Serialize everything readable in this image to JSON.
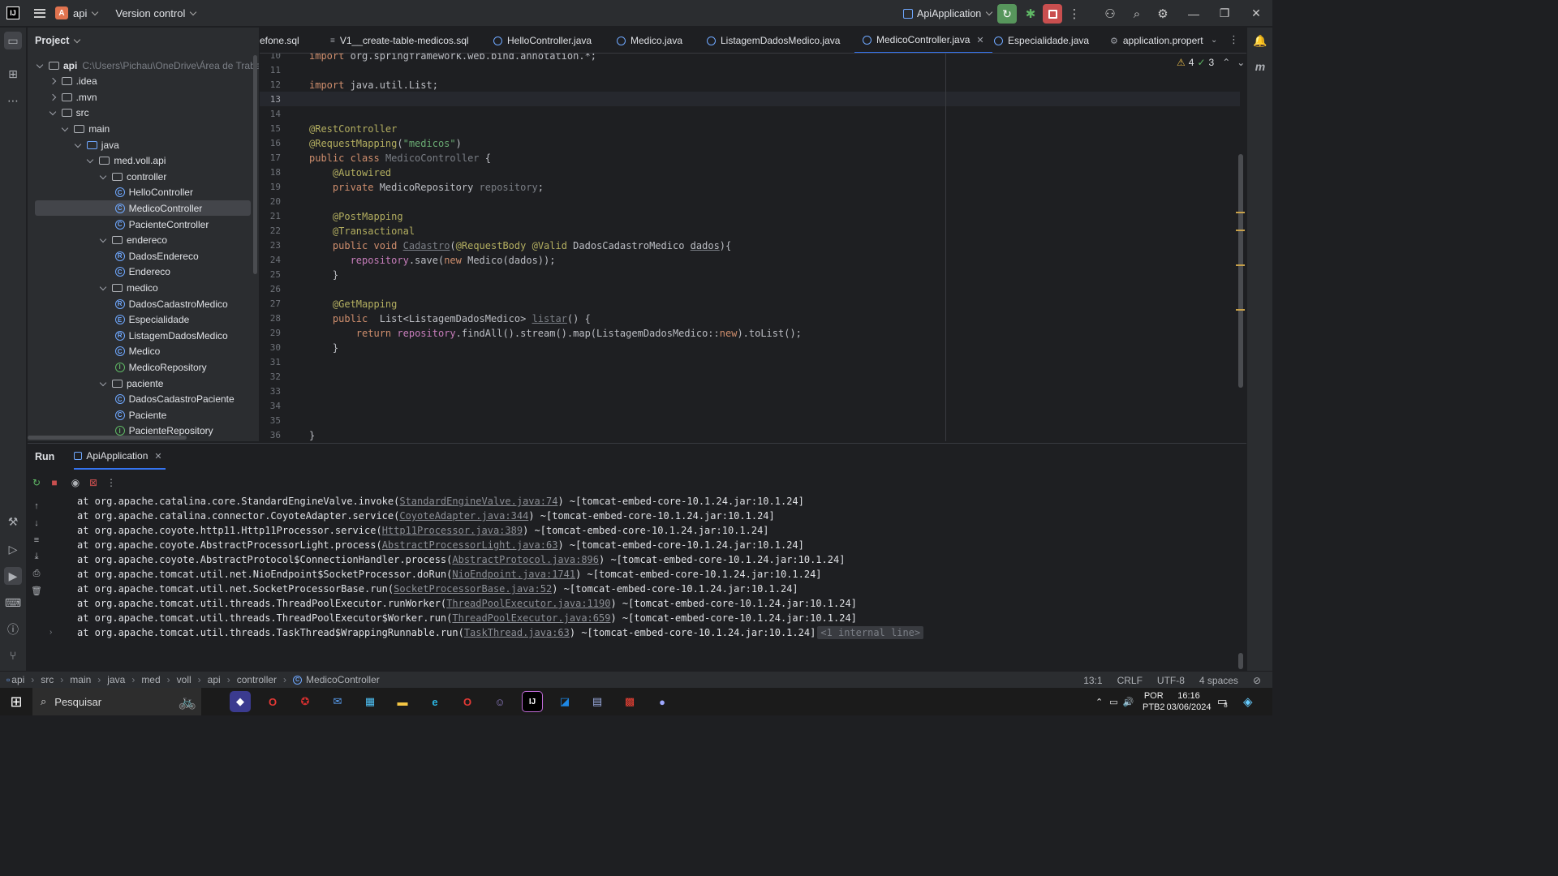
{
  "titlebar": {
    "project_badge": "A",
    "project_name": "api",
    "vcs_label": "Version control",
    "run_config": "ApiApplication",
    "colors": {
      "rerun": "#57965c",
      "stop": "#c94f4f",
      "badge": "#e0734f"
    }
  },
  "project_panel": {
    "title": "Project",
    "tree": [
      {
        "label": "api",
        "hint": "C:\\Users\\Pichau\\OneDrive\\Área de Trabalho",
        "type": "module",
        "arrow": "down",
        "indent": 0
      },
      {
        "label": ".idea",
        "type": "folder",
        "arrow": "right",
        "indent": 1
      },
      {
        "label": ".mvn",
        "type": "folder",
        "arrow": "right",
        "indent": 1
      },
      {
        "label": "src",
        "type": "folder",
        "arrow": "down",
        "indent": 1
      },
      {
        "label": "main",
        "type": "folder",
        "arrow": "down",
        "indent": 2
      },
      {
        "label": "java",
        "type": "folder-blue",
        "arrow": "down",
        "indent": 3
      },
      {
        "label": "med.voll.api",
        "type": "package",
        "arrow": "down",
        "indent": 4
      },
      {
        "label": "controller",
        "type": "package",
        "arrow": "down",
        "indent": 5
      },
      {
        "label": "HelloController",
        "type": "class",
        "indent": 6
      },
      {
        "label": "MedicoController",
        "type": "class",
        "indent": 6,
        "selected": true
      },
      {
        "label": "PacienteController",
        "type": "class",
        "indent": 6
      },
      {
        "label": "endereco",
        "type": "package",
        "arrow": "down",
        "indent": 5
      },
      {
        "label": "DadosEndereco",
        "type": "record",
        "indent": 6
      },
      {
        "label": "Endereco",
        "type": "class",
        "indent": 6
      },
      {
        "label": "medico",
        "type": "package",
        "arrow": "down",
        "indent": 5
      },
      {
        "label": "DadosCadastroMedico",
        "type": "record",
        "indent": 6
      },
      {
        "label": "Especialidade",
        "type": "enum",
        "indent": 6
      },
      {
        "label": "ListagemDadosMedico",
        "type": "record",
        "indent": 6
      },
      {
        "label": "Medico",
        "type": "class",
        "indent": 6
      },
      {
        "label": "MedicoRepository",
        "type": "interface",
        "indent": 6
      },
      {
        "label": "paciente",
        "type": "package",
        "arrow": "down",
        "indent": 5
      },
      {
        "label": "DadosCadastroPaciente",
        "type": "class",
        "indent": 6
      },
      {
        "label": "Paciente",
        "type": "class",
        "indent": 6
      },
      {
        "label": "PacienteRepository",
        "type": "interface",
        "indent": 6
      }
    ]
  },
  "editor_tabs": [
    {
      "label": "efone.sql",
      "icon": "sql"
    },
    {
      "label": "V1__create-table-medicos.sql",
      "icon": "sql"
    },
    {
      "label": "HelloController.java",
      "icon": "class"
    },
    {
      "label": "Medico.java",
      "icon": "class"
    },
    {
      "label": "ListagemDadosMedico.java",
      "icon": "record"
    },
    {
      "label": "MedicoController.java",
      "icon": "class",
      "active": true
    },
    {
      "label": "Especialidade.java",
      "icon": "enum"
    },
    {
      "label": "application.propert",
      "icon": "gear"
    }
  ],
  "inspections": {
    "warnings": "4",
    "checks": "3"
  },
  "code_lines": [
    {
      "n": "10",
      "html": "<span class=\"kw\">import</span> org.springframework.web.bind.annotation.*;"
    },
    {
      "n": "11",
      "html": ""
    },
    {
      "n": "12",
      "html": "<span class=\"kw\">import</span> java.util.List;"
    },
    {
      "n": "13",
      "html": ""
    },
    {
      "n": "14",
      "html": ""
    },
    {
      "n": "15",
      "html": "<span class=\"ann\">@RestController</span>"
    },
    {
      "n": "16",
      "html": "<span class=\"ann\">@RequestMapping</span>(<span class=\"str\">\"medicos\"</span>)"
    },
    {
      "n": "17",
      "html": "<span class=\"kw\">public class</span> <span class=\"dim\">MedicoController</span> {"
    },
    {
      "n": "18",
      "html": "    <span class=\"ann\">@Autowired</span>"
    },
    {
      "n": "19",
      "html": "    <span class=\"kw\">private</span> MedicoRepository <span class=\"dim\">repository</span>;"
    },
    {
      "n": "20",
      "html": ""
    },
    {
      "n": "21",
      "html": "    <span class=\"ann\">@PostMapping</span>"
    },
    {
      "n": "22",
      "html": "    <span class=\"ann\">@Transactional</span>"
    },
    {
      "n": "23",
      "html": "    <span class=\"kw\">public void</span> <span class=\"dim under\">Cadastro</span>(<span class=\"ann\">@RequestBody</span> <span class=\"ann\">@Valid</span> DadosCadastroMedico <span class=\"under\">dados</span>){"
    },
    {
      "n": "24",
      "html": "       <span class=\"fld\">repository</span>.save(<span class=\"kw\">new</span> Medico(dados));"
    },
    {
      "n": "25",
      "html": "    }"
    },
    {
      "n": "26",
      "html": ""
    },
    {
      "n": "27",
      "html": "    <span class=\"ann\">@GetMapping</span>"
    },
    {
      "n": "28",
      "html": "    <span class=\"kw\">public</span>  List&lt;ListagemDadosMedico&gt; <span class=\"dim under\">listar</span>() {"
    },
    {
      "n": "29",
      "html": "        <span class=\"kw\">return</span> <span class=\"fld\">repository</span>.findAll().stream().map(ListagemDadosMedico::<span class=\"kw\">new</span>).toList();"
    },
    {
      "n": "30",
      "html": "    }"
    },
    {
      "n": "31",
      "html": ""
    },
    {
      "n": "32",
      "html": ""
    },
    {
      "n": "33",
      "html": ""
    },
    {
      "n": "34",
      "html": ""
    },
    {
      "n": "35",
      "html": ""
    },
    {
      "n": "36",
      "html": "}"
    }
  ],
  "run_panel": {
    "label": "Run",
    "tab": "ApiApplication",
    "log": [
      {
        "pre": "at org.apache.catalina.core.StandardEngineValve.invoke(",
        "link": "StandardEngineValve.java:74",
        "post": ") ~[tomcat-embed-core-10.1.24.jar:10.1.24]"
      },
      {
        "pre": "at org.apache.catalina.connector.CoyoteAdapter.service(",
        "link": "CoyoteAdapter.java:344",
        "post": ") ~[tomcat-embed-core-10.1.24.jar:10.1.24]"
      },
      {
        "pre": "at org.apache.coyote.http11.Http11Processor.service(",
        "link": "Http11Processor.java:389",
        "post": ") ~[tomcat-embed-core-10.1.24.jar:10.1.24]"
      },
      {
        "pre": "at org.apache.coyote.AbstractProcessorLight.process(",
        "link": "AbstractProcessorLight.java:63",
        "post": ") ~[tomcat-embed-core-10.1.24.jar:10.1.24]"
      },
      {
        "pre": "at org.apache.coyote.AbstractProtocol$ConnectionHandler.process(",
        "link": "AbstractProtocol.java:896",
        "post": ") ~[tomcat-embed-core-10.1.24.jar:10.1.24]"
      },
      {
        "pre": "at org.apache.tomcat.util.net.NioEndpoint$SocketProcessor.doRun(",
        "link": "NioEndpoint.java:1741",
        "post": ") ~[tomcat-embed-core-10.1.24.jar:10.1.24]"
      },
      {
        "pre": "at org.apache.tomcat.util.net.SocketProcessorBase.run(",
        "link": "SocketProcessorBase.java:52",
        "post": ") ~[tomcat-embed-core-10.1.24.jar:10.1.24]"
      },
      {
        "pre": "at org.apache.tomcat.util.threads.ThreadPoolExecutor.runWorker(",
        "link": "ThreadPoolExecutor.java:1190",
        "post": ") ~[tomcat-embed-core-10.1.24.jar:10.1.24]"
      },
      {
        "pre": "at org.apache.tomcat.util.threads.ThreadPoolExecutor$Worker.run(",
        "link": "ThreadPoolExecutor.java:659",
        "post": ") ~[tomcat-embed-core-10.1.24.jar:10.1.24]"
      },
      {
        "pre": "at org.apache.tomcat.util.threads.TaskThread$WrappingRunnable.run(",
        "link": "TaskThread.java:63",
        "post": ") ~[tomcat-embed-core-10.1.24.jar:10.1.24]",
        "internal": "<1 internal line>"
      }
    ]
  },
  "statusbar": {
    "breadcrumb": [
      "api",
      "src",
      "main",
      "java",
      "med",
      "voll",
      "api",
      "controller",
      "MedicoController"
    ],
    "position": "13:1",
    "line_sep": "CRLF",
    "encoding": "UTF-8",
    "indent": "4 spaces"
  },
  "taskbar": {
    "search_placeholder": "Pesquisar",
    "lang1": "POR",
    "lang2": "PTB2",
    "time": "16:16",
    "date": "03/06/2024",
    "notif_count": "8"
  }
}
